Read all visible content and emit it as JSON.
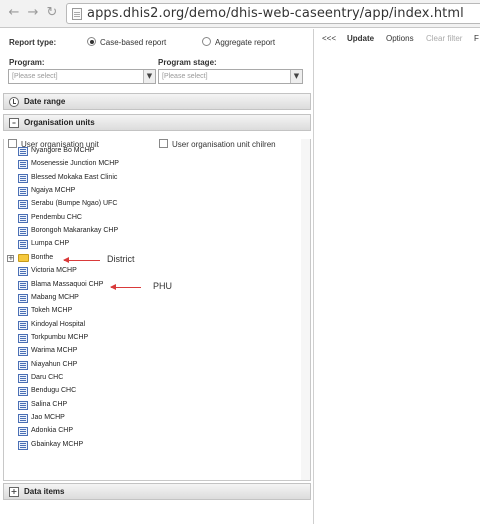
{
  "browser": {
    "back_icon": "back-arrow-icon",
    "forward_icon": "forward-arrow-icon",
    "url": "apps.dhis2.org/demo/dhis-web-caseentry/app/index.html"
  },
  "left_panel": {
    "report_type_label": "Report type:",
    "report_type_options": [
      "Case-based report",
      "Aggregate report"
    ],
    "selected_report_type": "Case-based report",
    "program_label": "Program:",
    "program_placeholder": "[Please select]",
    "program_stage_label": "Program stage:",
    "program_stage_placeholder": "[Please select]",
    "sections": {
      "date_range": "Date range",
      "organisation_units": "Organisation units",
      "data_items": "Data items"
    },
    "org_options": {
      "user_org_unit": "User organisation unit",
      "user_org_unit_children": "User organisation unit chilren"
    },
    "tree_items": [
      {
        "label": "Nyangore Bo MCHP",
        "type": "unit"
      },
      {
        "label": "Mosenessie Junction MCHP",
        "type": "unit"
      },
      {
        "label": "Blessed Mokaka East Clinic",
        "type": "unit"
      },
      {
        "label": "Ngaiya MCHP",
        "type": "unit"
      },
      {
        "label": "Serabu (Bumpe Ngao) UFC",
        "type": "unit"
      },
      {
        "label": "Pendembu CHC",
        "type": "unit"
      },
      {
        "label": "Borongoh Makarankay CHP",
        "type": "unit"
      },
      {
        "label": "Lumpa CHP",
        "type": "unit"
      },
      {
        "label": "Bonthe",
        "type": "folder"
      },
      {
        "label": "Victoria MCHP",
        "type": "unit"
      },
      {
        "label": "Blama Massaquoi CHP",
        "type": "unit"
      },
      {
        "label": "Mabang MCHP",
        "type": "unit"
      },
      {
        "label": "Tokeh MCHP",
        "type": "unit"
      },
      {
        "label": "Kindoyal Hospital",
        "type": "unit"
      },
      {
        "label": "Torkpumbu MCHP",
        "type": "unit"
      },
      {
        "label": "Warima MCHP",
        "type": "unit"
      },
      {
        "label": "Niayahun CHP",
        "type": "unit"
      },
      {
        "label": "Daru CHC",
        "type": "unit"
      },
      {
        "label": "Bendugu CHC",
        "type": "unit"
      },
      {
        "label": "Salina CHP",
        "type": "unit"
      },
      {
        "label": "Jao MCHP",
        "type": "unit"
      },
      {
        "label": "Adonkia CHP",
        "type": "unit"
      },
      {
        "label": "Gbainkay MCHP",
        "type": "unit"
      }
    ],
    "annotations": {
      "district": "District",
      "phu": "PHU",
      "arrow_color": "#d93a3a"
    }
  },
  "right_panel": {
    "toolbar": {
      "collapse": "<<<",
      "update": "Update",
      "options": "Options",
      "clear_filter": "Clear filter",
      "truncated": "F"
    }
  }
}
